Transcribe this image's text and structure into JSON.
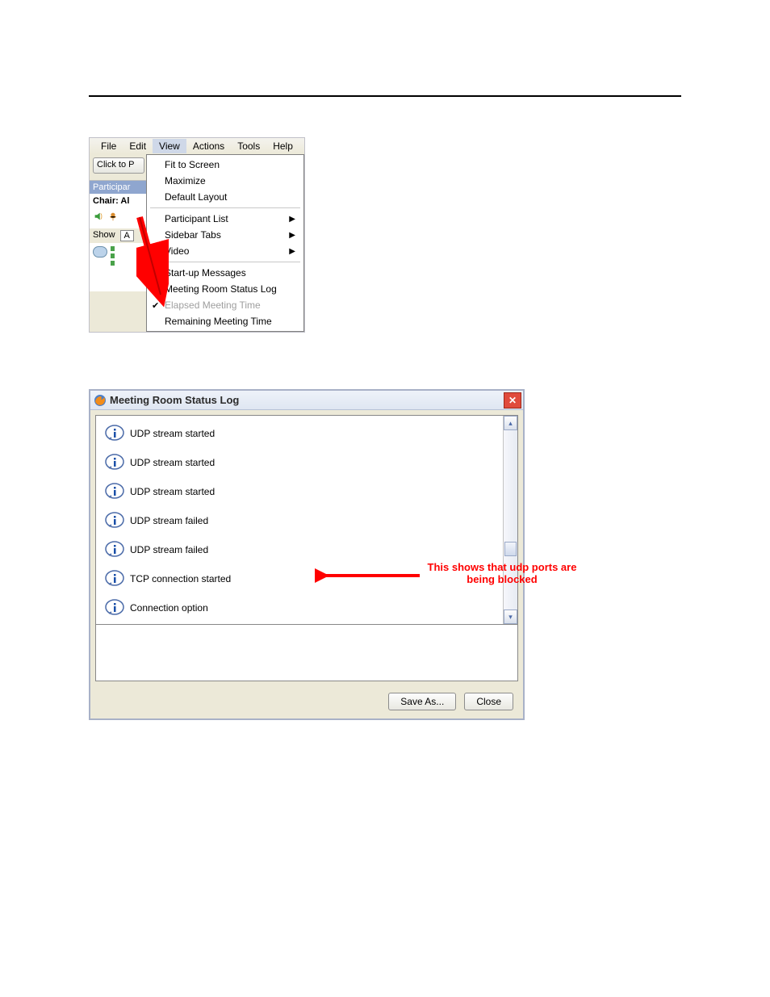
{
  "shot1": {
    "menubar": {
      "file": "File",
      "edit": "Edit",
      "view": "View",
      "actions": "Actions",
      "tools": "Tools",
      "help": "Help"
    },
    "click_button": "Click to P",
    "participants_label": "Participar",
    "chair_label": "Chair: Al",
    "show_label": "Show",
    "show_a": "A",
    "view_menu": {
      "fit": "Fit to Screen",
      "maximize": "Maximize",
      "default_layout": "Default Layout",
      "participant_list": "Participant List",
      "sidebar_tabs": "Sidebar Tabs",
      "video": "Video",
      "startup": "Start-up Messages",
      "status_log": "Meeting Room Status Log",
      "elapsed": "Elapsed Meeting Time",
      "remaining": "Remaining Meeting Time"
    }
  },
  "shot2": {
    "title": "Meeting Room Status Log",
    "log": [
      "UDP stream started",
      "UDP stream started",
      "UDP stream started",
      "UDP stream failed",
      "UDP stream failed",
      "TCP connection started",
      "Connection option"
    ],
    "save_as": "Save As...",
    "close": "Close",
    "annotation_line1": "This shows that udp ports are",
    "annotation_line2": "being blocked"
  }
}
